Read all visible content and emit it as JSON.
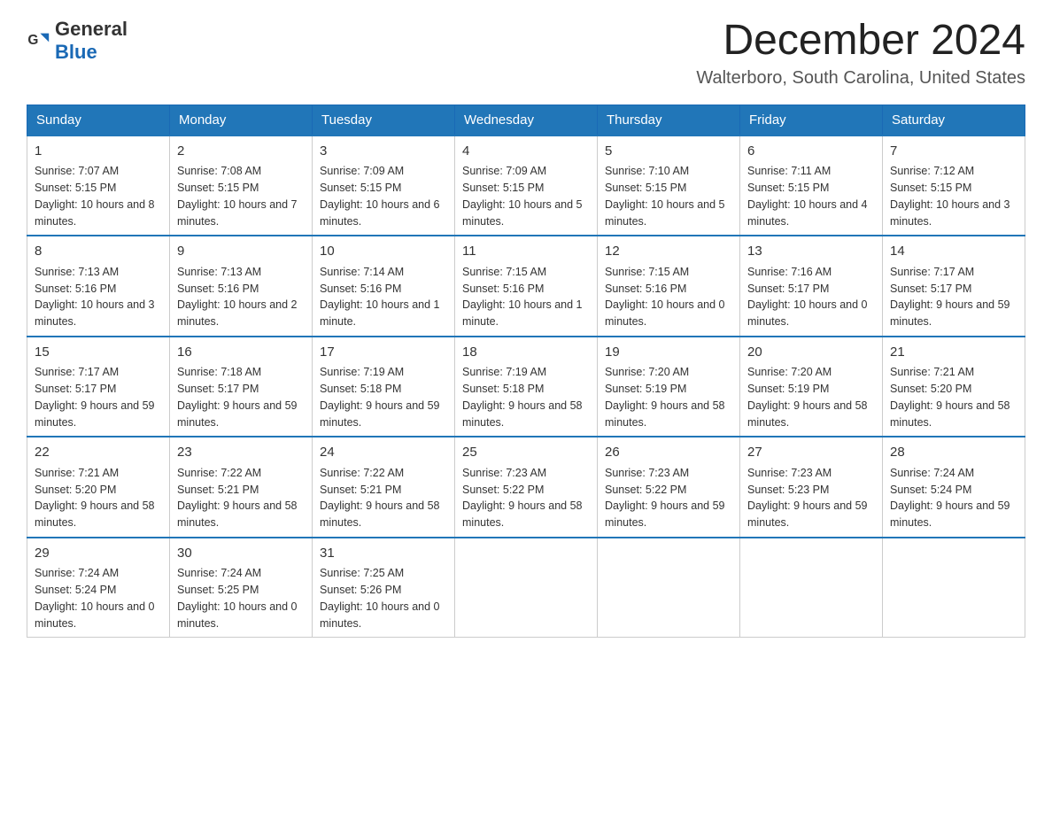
{
  "header": {
    "logo_general": "General",
    "logo_blue": "Blue",
    "month_title": "December 2024",
    "location": "Walterboro, South Carolina, United States"
  },
  "days_of_week": [
    "Sunday",
    "Monday",
    "Tuesday",
    "Wednesday",
    "Thursday",
    "Friday",
    "Saturday"
  ],
  "weeks": [
    [
      {
        "day": "1",
        "sunrise": "7:07 AM",
        "sunset": "5:15 PM",
        "daylight": "10 hours and 8 minutes."
      },
      {
        "day": "2",
        "sunrise": "7:08 AM",
        "sunset": "5:15 PM",
        "daylight": "10 hours and 7 minutes."
      },
      {
        "day": "3",
        "sunrise": "7:09 AM",
        "sunset": "5:15 PM",
        "daylight": "10 hours and 6 minutes."
      },
      {
        "day": "4",
        "sunrise": "7:09 AM",
        "sunset": "5:15 PM",
        "daylight": "10 hours and 5 minutes."
      },
      {
        "day": "5",
        "sunrise": "7:10 AM",
        "sunset": "5:15 PM",
        "daylight": "10 hours and 5 minutes."
      },
      {
        "day": "6",
        "sunrise": "7:11 AM",
        "sunset": "5:15 PM",
        "daylight": "10 hours and 4 minutes."
      },
      {
        "day": "7",
        "sunrise": "7:12 AM",
        "sunset": "5:15 PM",
        "daylight": "10 hours and 3 minutes."
      }
    ],
    [
      {
        "day": "8",
        "sunrise": "7:13 AM",
        "sunset": "5:16 PM",
        "daylight": "10 hours and 3 minutes."
      },
      {
        "day": "9",
        "sunrise": "7:13 AM",
        "sunset": "5:16 PM",
        "daylight": "10 hours and 2 minutes."
      },
      {
        "day": "10",
        "sunrise": "7:14 AM",
        "sunset": "5:16 PM",
        "daylight": "10 hours and 1 minute."
      },
      {
        "day": "11",
        "sunrise": "7:15 AM",
        "sunset": "5:16 PM",
        "daylight": "10 hours and 1 minute."
      },
      {
        "day": "12",
        "sunrise": "7:15 AM",
        "sunset": "5:16 PM",
        "daylight": "10 hours and 0 minutes."
      },
      {
        "day": "13",
        "sunrise": "7:16 AM",
        "sunset": "5:17 PM",
        "daylight": "10 hours and 0 minutes."
      },
      {
        "day": "14",
        "sunrise": "7:17 AM",
        "sunset": "5:17 PM",
        "daylight": "9 hours and 59 minutes."
      }
    ],
    [
      {
        "day": "15",
        "sunrise": "7:17 AM",
        "sunset": "5:17 PM",
        "daylight": "9 hours and 59 minutes."
      },
      {
        "day": "16",
        "sunrise": "7:18 AM",
        "sunset": "5:17 PM",
        "daylight": "9 hours and 59 minutes."
      },
      {
        "day": "17",
        "sunrise": "7:19 AM",
        "sunset": "5:18 PM",
        "daylight": "9 hours and 59 minutes."
      },
      {
        "day": "18",
        "sunrise": "7:19 AM",
        "sunset": "5:18 PM",
        "daylight": "9 hours and 58 minutes."
      },
      {
        "day": "19",
        "sunrise": "7:20 AM",
        "sunset": "5:19 PM",
        "daylight": "9 hours and 58 minutes."
      },
      {
        "day": "20",
        "sunrise": "7:20 AM",
        "sunset": "5:19 PM",
        "daylight": "9 hours and 58 minutes."
      },
      {
        "day": "21",
        "sunrise": "7:21 AM",
        "sunset": "5:20 PM",
        "daylight": "9 hours and 58 minutes."
      }
    ],
    [
      {
        "day": "22",
        "sunrise": "7:21 AM",
        "sunset": "5:20 PM",
        "daylight": "9 hours and 58 minutes."
      },
      {
        "day": "23",
        "sunrise": "7:22 AM",
        "sunset": "5:21 PM",
        "daylight": "9 hours and 58 minutes."
      },
      {
        "day": "24",
        "sunrise": "7:22 AM",
        "sunset": "5:21 PM",
        "daylight": "9 hours and 58 minutes."
      },
      {
        "day": "25",
        "sunrise": "7:23 AM",
        "sunset": "5:22 PM",
        "daylight": "9 hours and 58 minutes."
      },
      {
        "day": "26",
        "sunrise": "7:23 AM",
        "sunset": "5:22 PM",
        "daylight": "9 hours and 59 minutes."
      },
      {
        "day": "27",
        "sunrise": "7:23 AM",
        "sunset": "5:23 PM",
        "daylight": "9 hours and 59 minutes."
      },
      {
        "day": "28",
        "sunrise": "7:24 AM",
        "sunset": "5:24 PM",
        "daylight": "9 hours and 59 minutes."
      }
    ],
    [
      {
        "day": "29",
        "sunrise": "7:24 AM",
        "sunset": "5:24 PM",
        "daylight": "10 hours and 0 minutes."
      },
      {
        "day": "30",
        "sunrise": "7:24 AM",
        "sunset": "5:25 PM",
        "daylight": "10 hours and 0 minutes."
      },
      {
        "day": "31",
        "sunrise": "7:25 AM",
        "sunset": "5:26 PM",
        "daylight": "10 hours and 0 minutes."
      },
      null,
      null,
      null,
      null
    ]
  ]
}
